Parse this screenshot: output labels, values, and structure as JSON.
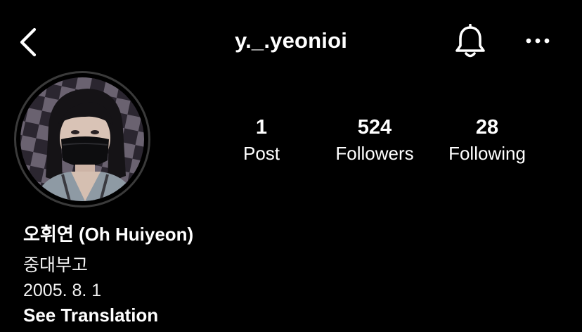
{
  "header": {
    "username": "y._.yeonioi",
    "back_icon": "chevron-left-icon",
    "notification_icon": "bell-icon",
    "more_icon": "more-horizontal-icon"
  },
  "profile": {
    "avatar_description_icon": "profile-photo",
    "stats": [
      {
        "value": "1",
        "label": "Post"
      },
      {
        "value": "524",
        "label": "Followers"
      },
      {
        "value": "28",
        "label": "Following"
      }
    ],
    "name": "오휘연 (Oh Huiyeon)",
    "bio_lines": [
      "중대부고",
      "2005. 8. 1"
    ],
    "see_translation": "See Translation"
  },
  "colors": {
    "background": "#000000",
    "text": "#ffffff",
    "avatar_ring": "#3a3a3a"
  }
}
